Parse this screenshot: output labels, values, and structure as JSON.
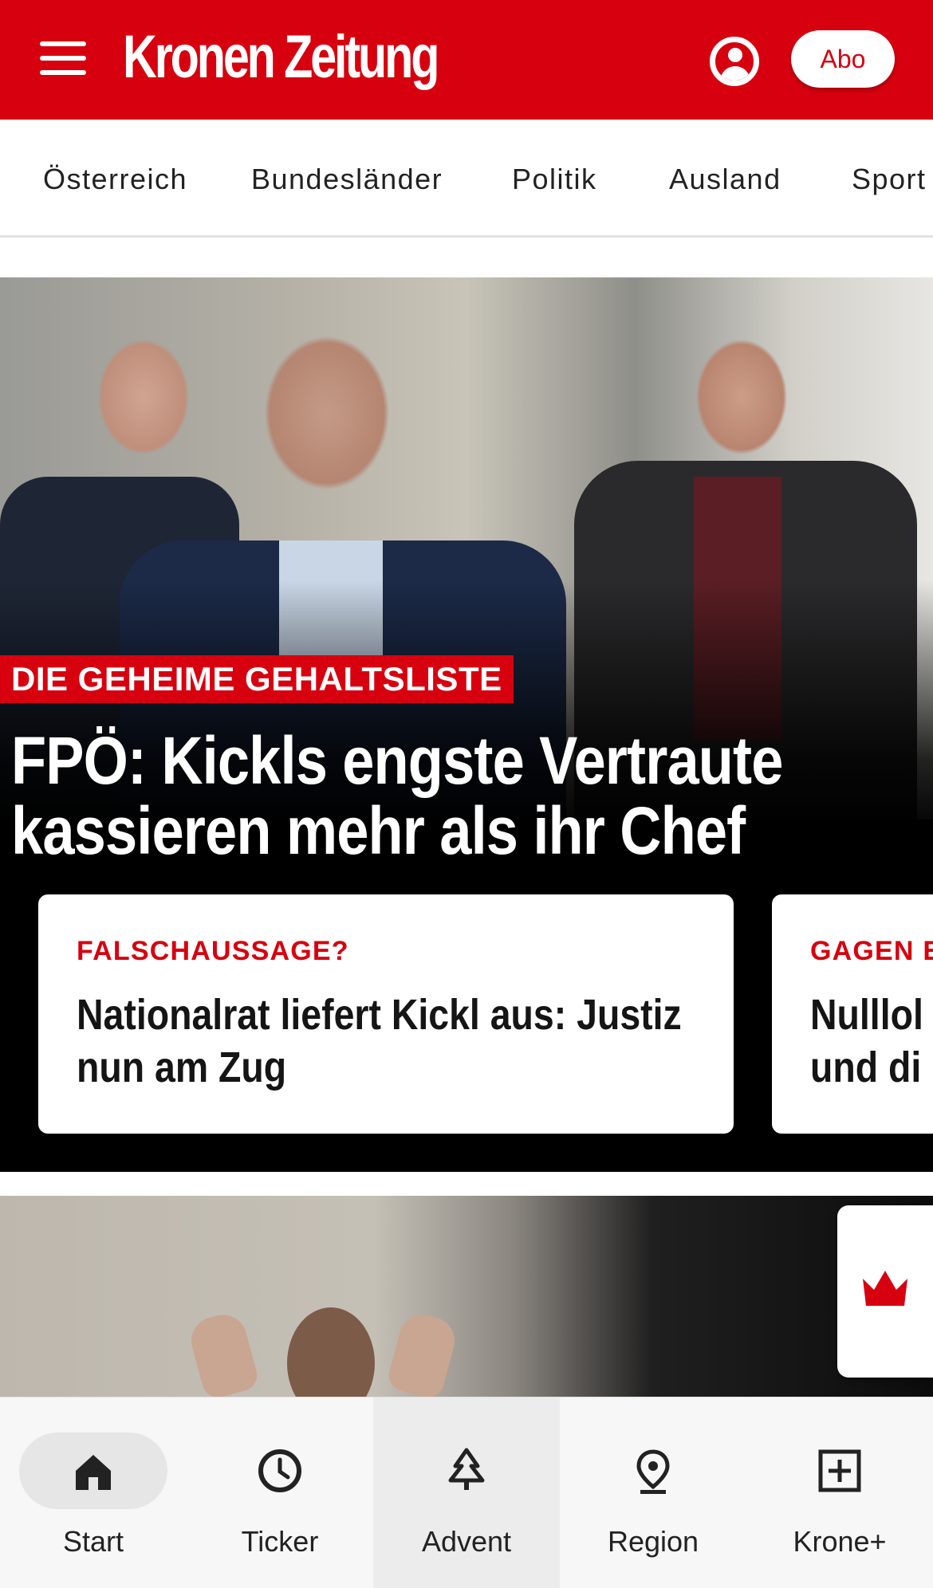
{
  "header": {
    "logo_text": "Kronen Zeitung",
    "abo_label": "Abo",
    "brand_color": "#d7000f"
  },
  "categories": [
    "Österreich",
    "Bundesländer",
    "Politik",
    "Ausland",
    "Sport"
  ],
  "hero": {
    "kicker": "DIE GEHEIME GEHALTSLISTE",
    "headline": "FPÖ: Kickls engste Vertraute kassieren mehr als ihr Chef"
  },
  "subcards": [
    {
      "kicker": "FALSCHAUSSAGE?",
      "title": "Nationalrat liefert Kickl aus: Justiz nun am Zug"
    },
    {
      "kicker": "GAGEN E",
      "title": "Nulllol und di"
    }
  ],
  "bottom_nav": [
    {
      "label": "Start",
      "icon": "home-icon",
      "active": true
    },
    {
      "label": "Ticker",
      "icon": "clock-icon"
    },
    {
      "label": "Advent",
      "icon": "tree-icon"
    },
    {
      "label": "Region",
      "icon": "location-pin-icon"
    },
    {
      "label": "Krone+",
      "icon": "plus-box-icon"
    }
  ]
}
